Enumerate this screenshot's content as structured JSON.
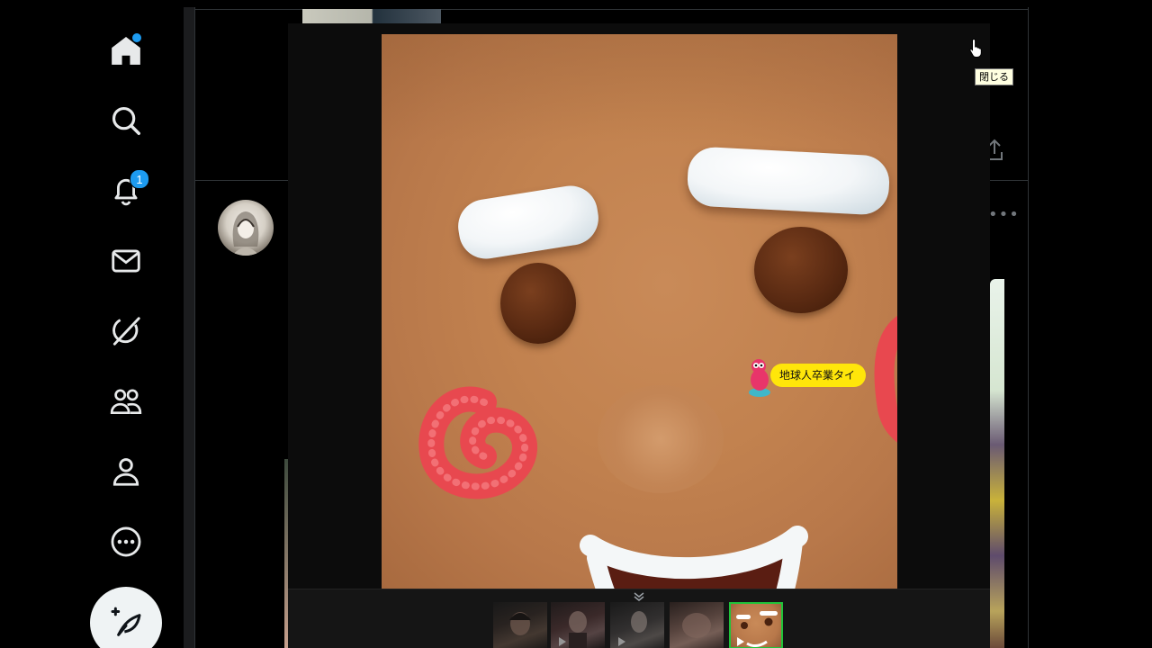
{
  "nav": {
    "items": [
      {
        "name": "home",
        "icon": "home-icon",
        "has_dot": true
      },
      {
        "name": "explore",
        "icon": "search-icon"
      },
      {
        "name": "notifications",
        "icon": "bell-icon",
        "badge": "1"
      },
      {
        "name": "messages",
        "icon": "mail-icon"
      },
      {
        "name": "grok",
        "icon": "grok-icon"
      },
      {
        "name": "communities",
        "icon": "people-icon"
      },
      {
        "name": "profile",
        "icon": "person-icon"
      },
      {
        "name": "more",
        "icon": "more-circle-icon"
      }
    ],
    "post_button_icon": "feather-plus-icon"
  },
  "lightbox": {
    "close_tooltip": "閉じる",
    "sticker_label": "地球人卒業タイ",
    "filmstrip": {
      "thumbnails": [
        {
          "label": "thumbnail-1",
          "has_play": false,
          "active": false
        },
        {
          "label": "thumbnail-2",
          "has_play": true,
          "active": false
        },
        {
          "label": "thumbnail-3",
          "has_play": true,
          "active": false
        },
        {
          "label": "thumbnail-4",
          "has_play": false,
          "active": false
        },
        {
          "label": "thumbnail-5",
          "has_play": true,
          "active": true
        }
      ]
    }
  },
  "colors": {
    "accent": "#1d9bf0",
    "active_thumb_outline": "#20c43a",
    "sticker_bg": "#ffe60a",
    "tooltip_bg": "#ffffe1"
  }
}
